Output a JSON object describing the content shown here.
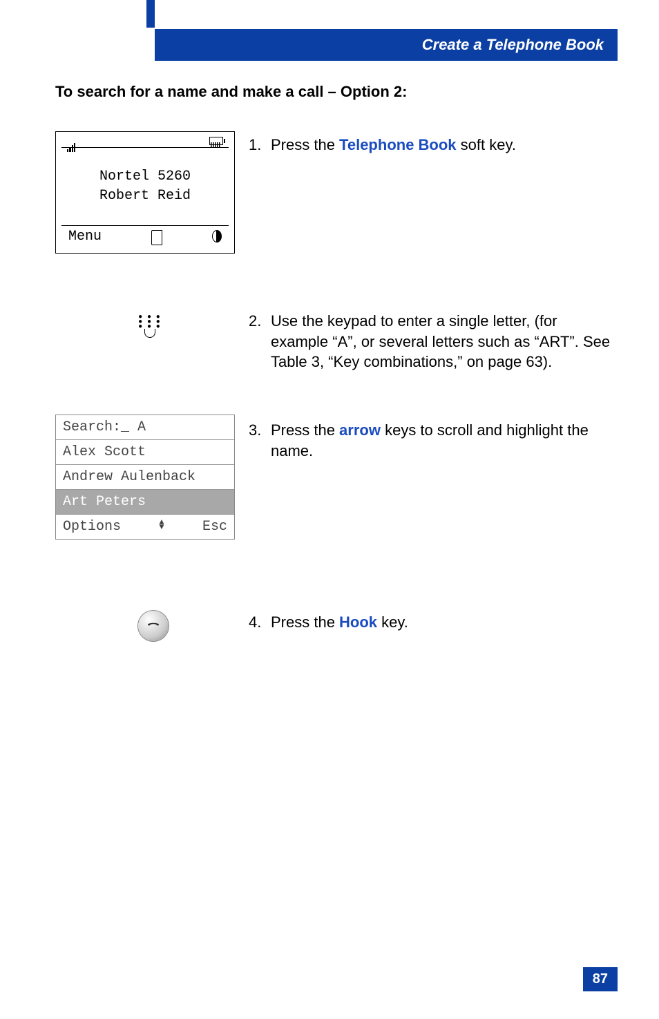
{
  "header": {
    "title": "Create a Telephone Book"
  },
  "subtitle": "To search for a name and make a call – Option 2:",
  "steps": {
    "s1": {
      "num": "1.",
      "pre": "Press the ",
      "kw": "Telephone Book",
      "post": " soft key."
    },
    "s2": {
      "num": "2.",
      "text": "Use the keypad to enter a single letter, (for example “A”, or several letters such as “ART”. See Table 3, “Key combinations,” on page 63)."
    },
    "s3": {
      "num": "3.",
      "pre": "Press the ",
      "kw": "arrow",
      "post": " keys to scroll and highlight the name."
    },
    "s4": {
      "num": "4.",
      "pre": "Press the ",
      "kw": "Hook",
      "post": " key."
    }
  },
  "frame1": {
    "line1": "Nortel 5260",
    "line2": "Robert Reid",
    "menu": "Menu"
  },
  "frame2": {
    "search_label": "Search:_  A",
    "items": [
      "Alex Scott",
      "Andrew Aulenback",
      "Art Peters"
    ],
    "highlight_index": 2,
    "options": "Options",
    "esc": "Esc"
  },
  "page_number": "87"
}
